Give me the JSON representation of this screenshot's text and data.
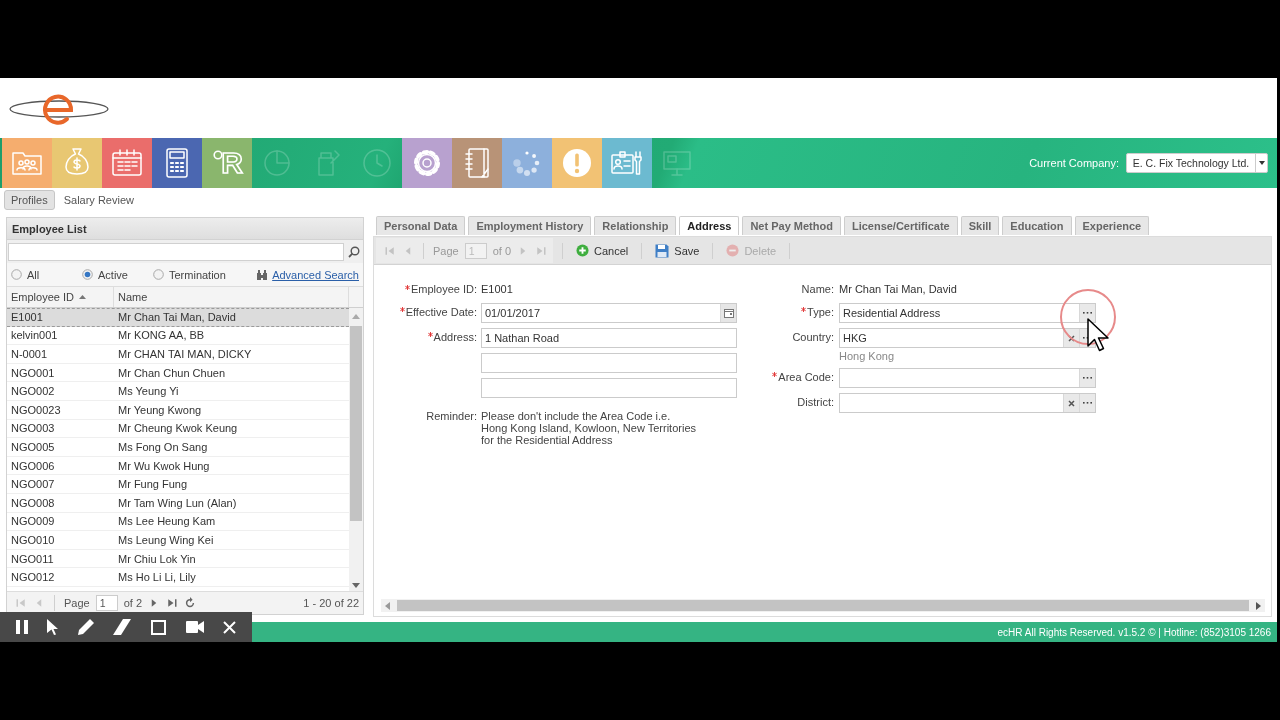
{
  "module_bar": {
    "tiles": [
      {
        "kind": "folder-people",
        "color": "#f5ad6e",
        "disabled": false
      },
      {
        "kind": "money-bag",
        "color": "#e8c772",
        "disabled": false
      },
      {
        "kind": "calendar",
        "color": "#ea6d6b",
        "disabled": false
      },
      {
        "kind": "calculator",
        "color": "#4b67b1",
        "disabled": false
      },
      {
        "kind": "letter-mark",
        "mark": "R",
        "color": "#8ab66d",
        "disabled": false
      },
      {
        "kind": "pie-chart",
        "disabled": true
      },
      {
        "kind": "jar",
        "disabled": true
      },
      {
        "kind": "clock",
        "disabled": true
      },
      {
        "kind": "gear",
        "color": "#b8a1cf",
        "disabled": false
      },
      {
        "kind": "notebook",
        "color": "#b89377",
        "disabled": false
      },
      {
        "kind": "spinner",
        "color": "#8db0dc",
        "disabled": false
      },
      {
        "kind": "alert",
        "color": "#f2c274",
        "disabled": false
      },
      {
        "kind": "id-card",
        "color": "#6cbad0",
        "disabled": false
      },
      {
        "kind": "monitor",
        "disabled": true
      }
    ],
    "company": {
      "label": "Current Company:",
      "value": "E. C. Fix Technology Ltd."
    }
  },
  "subtabs": [
    {
      "label": "Profiles",
      "selected": true
    },
    {
      "label": "Salary Review",
      "selected": false
    }
  ],
  "employee_list": {
    "title": "Employee List",
    "filters": [
      {
        "label": "All",
        "selected": false
      },
      {
        "label": "Active",
        "selected": true
      },
      {
        "label": "Termination",
        "selected": false
      }
    ],
    "advanced_search": "Advanced Search",
    "columns": [
      {
        "label": "Employee ID",
        "sorted": true
      },
      {
        "label": "Name",
        "sorted": false
      }
    ],
    "rows": [
      {
        "id": "E1001",
        "name": "Mr Chan Tai Man, David",
        "selected": true
      },
      {
        "id": "kelvin001",
        "name": "Mr KONG AA, BB",
        "selected": false
      },
      {
        "id": "N-0001",
        "name": "Mr CHAN TAI MAN, DICKY",
        "selected": false
      },
      {
        "id": "NGO001",
        "name": "Mr Chan Chun Chuen",
        "selected": false
      },
      {
        "id": "NGO002",
        "name": "Ms Yeung Yi",
        "selected": false
      },
      {
        "id": "NGO0023",
        "name": "Mr Yeung Kwong",
        "selected": false
      },
      {
        "id": "NGO003",
        "name": "Mr Cheung Kwok Keung",
        "selected": false
      },
      {
        "id": "NGO005",
        "name": "Ms Fong On Sang",
        "selected": false
      },
      {
        "id": "NGO006",
        "name": "Mr Wu Kwok Hung",
        "selected": false
      },
      {
        "id": "NGO007",
        "name": "Mr Fung Fung",
        "selected": false
      },
      {
        "id": "NGO008",
        "name": "Mr Tam Wing Lun (Alan)",
        "selected": false
      },
      {
        "id": "NGO009",
        "name": "Ms Lee Heung Kam",
        "selected": false
      },
      {
        "id": "NGO010",
        "name": "Ms Leung Wing Kei",
        "selected": false
      },
      {
        "id": "NGO011",
        "name": "Mr Chiu Lok Yin",
        "selected": false
      },
      {
        "id": "NGO012",
        "name": "Ms Ho Li Li, Lily",
        "selected": false
      }
    ],
    "pager": {
      "page_label": "Page",
      "page": "1",
      "total": "of 2",
      "summary": "1 - 20 of 22",
      "nav": [
        {
          "kind": "first",
          "disabled": true
        },
        {
          "kind": "prev",
          "disabled": true
        },
        {
          "kind": "next",
          "disabled": false
        },
        {
          "kind": "last",
          "disabled": false
        },
        {
          "kind": "refresh",
          "disabled": false
        }
      ]
    }
  },
  "form_tabs": [
    {
      "label": "Personal Data",
      "selected": false
    },
    {
      "label": "Employment History",
      "selected": false
    },
    {
      "label": "Relationship",
      "selected": false
    },
    {
      "label": "Address",
      "selected": true
    },
    {
      "label": "Net Pay Method",
      "selected": false
    },
    {
      "label": "License/Certificate",
      "selected": false
    },
    {
      "label": "Skill",
      "selected": false
    },
    {
      "label": "Education",
      "selected": false
    },
    {
      "label": "Experience",
      "selected": false
    }
  ],
  "form_toolbar": {
    "pager": {
      "page_label": "Page",
      "page": "1",
      "total": "of 0",
      "disabled": true,
      "nav": [
        {
          "kind": "first",
          "disabled": true
        },
        {
          "kind": "prev",
          "disabled": true
        },
        {
          "kind": "next",
          "disabled": true
        },
        {
          "kind": "last",
          "disabled": true
        }
      ]
    },
    "actions": [
      {
        "kind": "cancel",
        "label": "Cancel",
        "disabled": false
      },
      {
        "kind": "save",
        "label": "Save",
        "disabled": false
      },
      {
        "kind": "delete",
        "label": "Delete",
        "disabled": true
      }
    ]
  },
  "form": {
    "left": [
      {
        "kind": "static",
        "label": "Employee ID:",
        "required": true,
        "value": "E1001"
      },
      {
        "kind": "date",
        "label": "Effective Date:",
        "required": true,
        "value": "01/01/2017"
      },
      {
        "kind": "text",
        "label": "Address:",
        "required": true,
        "value": "1 Nathan Road"
      },
      {
        "kind": "text",
        "required": false
      },
      {
        "kind": "text",
        "required": false
      },
      {
        "kind": "note",
        "label": "Reminder:",
        "required": false,
        "lines": [
          "Please don't include the Area Code i.e.",
          "Hong Kong Island, Kowloon, New Territories",
          "for the Residential Address"
        ]
      }
    ],
    "right": [
      {
        "kind": "static",
        "label": "Name:",
        "required": false,
        "value": "Mr Chan Tai Man, David"
      },
      {
        "kind": "lookup",
        "label": "Type:",
        "required": true,
        "value": "Residential Address",
        "clearable": false
      },
      {
        "kind": "lookup",
        "label": "Country:",
        "required": false,
        "value": "HKG",
        "clearable": true,
        "description": "Hong Kong"
      },
      {
        "kind": "lookup",
        "label": "Area Code:",
        "required": true,
        "clearable": false
      },
      {
        "kind": "lookup",
        "label": "District:",
        "required": false,
        "clearable": true
      }
    ]
  },
  "footer": {
    "text": "ecHR All Rights Reserved. v1.5.2 © | Hotline: (852)3105 1266"
  }
}
